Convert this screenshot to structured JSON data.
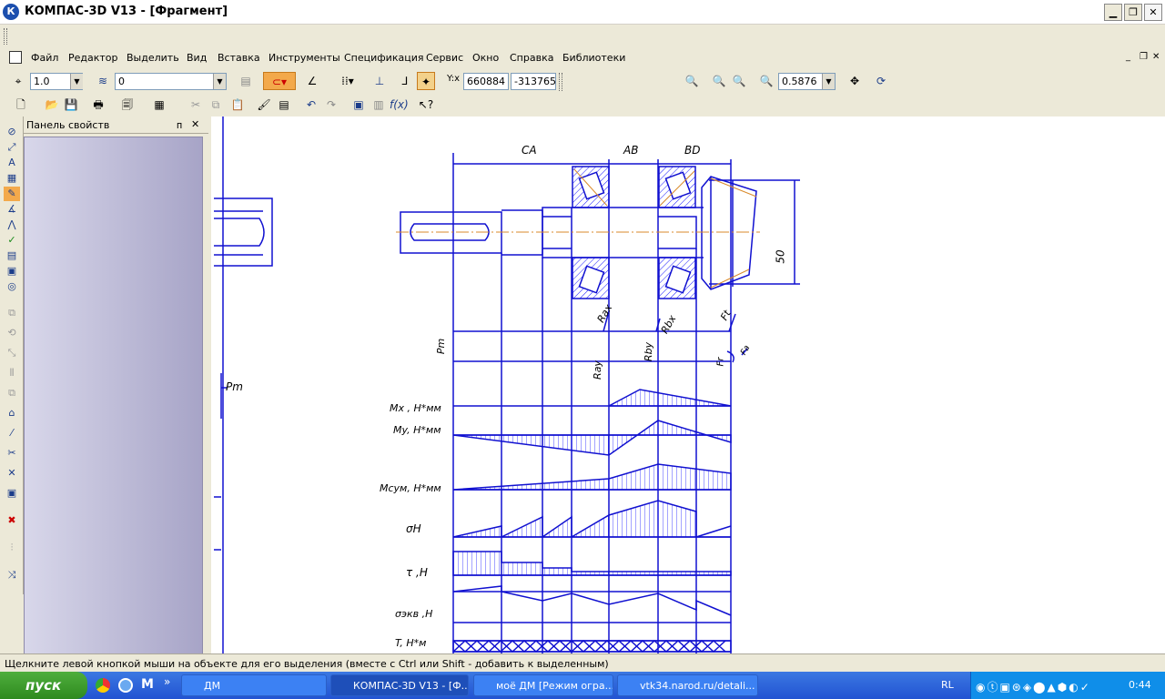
{
  "window": {
    "title": "КОМПАС-3D V13 - [Фрагмент]",
    "app_icon": "К"
  },
  "menu": {
    "items": [
      "Файл",
      "Редактор",
      "Выделить",
      "Вид",
      "Вставка",
      "Инструменты",
      "Спецификация",
      "Сервис",
      "Окно",
      "Справка",
      "Библиотеки"
    ]
  },
  "toolbar": {
    "scale_value": "1.0",
    "layer_value": "0",
    "coord_x": "660884",
    "coord_y": "-313765",
    "zoom_value": "0.5876",
    "coord_label": "Y:x"
  },
  "props_panel": {
    "title": "Панель свойств",
    "pin_label": "ᴨ",
    "close_label": "✕"
  },
  "drawing": {
    "dim_CA": "CA",
    "dim_AB": "AB",
    "dim_BD": "BD",
    "dim_50": "50",
    "label_Rax": "Rax",
    "label_Rbx": "Rbx",
    "label_Ft": "Ft",
    "label_Pm": "Pm",
    "label_Pm_left": "Pm",
    "label_Ray": "Ray",
    "label_Rby": "Rby",
    "label_Fr": "Fr",
    "label_Fa": "Fa",
    "row_labels": [
      "Mx , H*мм",
      "My, H*мм",
      "Mсум, H*мм",
      "σH",
      "τ ,H",
      "σэкв ,H",
      "T, H*м"
    ]
  },
  "status": {
    "text": "Щелкните левой кнопкой мыши на объекте для его выделения (вместе с Ctrl или Shift - добавить к выделенным)"
  },
  "taskbar": {
    "start_label": "пуск",
    "tasks": [
      "ДМ",
      "КОМПАС-3D V13 - [Ф...",
      "моё ДМ [Режим огра...",
      "vtk34.narod.ru/detali..."
    ],
    "lang": "RL",
    "clock": "0:44"
  }
}
